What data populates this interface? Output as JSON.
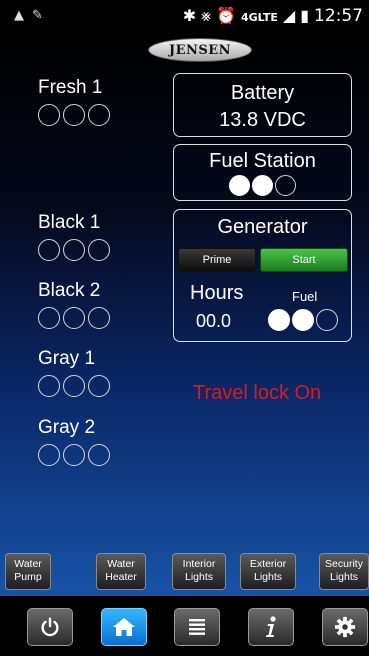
{
  "status_bar": {
    "signal_text": "4GLTE",
    "time": "12:57"
  },
  "app": {
    "logo": "JENSEN"
  },
  "tanks": [
    {
      "label": "Fresh 1",
      "level": 0
    },
    {
      "label": "Black 1",
      "level": 0
    },
    {
      "label": "Black 2",
      "level": 0
    },
    {
      "label": "Gray 1",
      "level": 0
    },
    {
      "label": "Gray 2",
      "level": 0
    }
  ],
  "battery": {
    "title": "Battery",
    "value": "13.8 VDC"
  },
  "fuel_station": {
    "title": "Fuel Station",
    "level": 2,
    "max": 3
  },
  "generator": {
    "title": "Generator",
    "prime_label": "Prime",
    "start_label": "Start",
    "hours_label": "Hours",
    "hours_value": "00.0",
    "fuel_label": "Fuel",
    "fuel_level": 2,
    "fuel_max": 3
  },
  "travel_lock": {
    "text": "Travel lock On",
    "color": "#e01818"
  },
  "toggles": [
    {
      "line1": "Water",
      "line2": "Pump"
    },
    {
      "line1": "Water",
      "line2": "Heater"
    },
    {
      "line1": "Interior",
      "line2": "Lights"
    },
    {
      "line1": "Exterior",
      "line2": "Lights"
    },
    {
      "line1": "Security",
      "line2": "Lights"
    }
  ],
  "nav": {
    "items": [
      {
        "icon": "power-icon",
        "active": false
      },
      {
        "icon": "home-icon",
        "active": true
      },
      {
        "icon": "list-icon",
        "active": false
      },
      {
        "icon": "info-icon",
        "active": false
      },
      {
        "icon": "gear-icon",
        "active": false
      }
    ],
    "active_color": "#1a8fe8"
  }
}
